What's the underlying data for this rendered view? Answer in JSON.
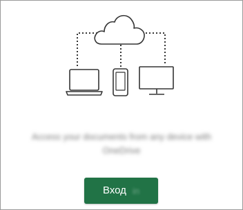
{
  "illustration": {
    "icons": [
      "cloud-icon",
      "laptop-icon",
      "phone-icon",
      "monitor-icon"
    ],
    "stroke_color": "#333333"
  },
  "caption": {
    "text": "Access your documents from any device with OneDrive"
  },
  "signin_button": {
    "label": "Вход",
    "trailing_text": "in",
    "background_color": "#217346",
    "text_color": "#ffffff"
  }
}
